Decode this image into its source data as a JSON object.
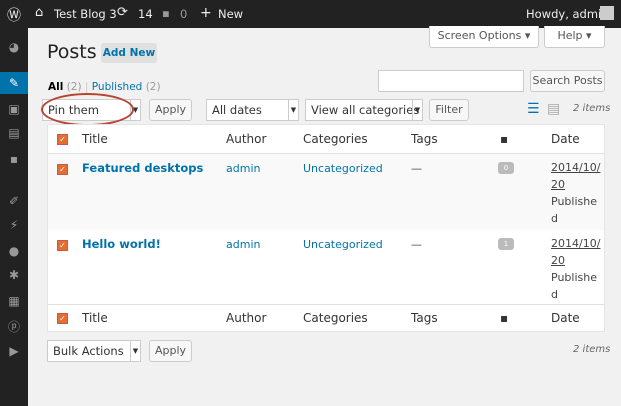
{
  "adminbar": {
    "site": "Test Blog 3",
    "updates": "14",
    "comments": "0",
    "new": "New",
    "howdy": "Howdy, admin"
  },
  "header": {
    "title": "Posts",
    "add_new": "Add New",
    "screen_options": "Screen Options ▾",
    "help": "Help ▾"
  },
  "views": {
    "all": "All",
    "all_count": "(2)",
    "sep": "|",
    "published": "Published",
    "published_count": "(2)"
  },
  "search": {
    "value": "",
    "button": "Search Posts"
  },
  "tablenav_top": {
    "bulk_selected": "Pin them",
    "apply": "Apply",
    "dates": "All dates",
    "categories": "View all categories",
    "filter": "Filter",
    "items": "2 items"
  },
  "columns": {
    "title": "Title",
    "author": "Author",
    "categories": "Categories",
    "tags": "Tags",
    "date": "Date"
  },
  "rows": [
    {
      "title": "Featured desktops",
      "author": "admin",
      "category": "Uncategorized",
      "tags": "—",
      "comments": "0",
      "date1": "2014/10/",
      "date2": "20",
      "status1": "Publishe",
      "status2": "d"
    },
    {
      "title": "Hello world!",
      "author": "admin",
      "category": "Uncategorized",
      "tags": "—",
      "comments": "1",
      "date1": "2014/10/",
      "date2": "20",
      "status1": "Publishe",
      "status2": "d"
    }
  ],
  "tablenav_bottom": {
    "bulk_selected": "Bulk Actions",
    "apply": "Apply",
    "items": "2 items"
  },
  "colors": {
    "accent": "#0073aa",
    "highlight": "#c0392b",
    "checkbox": "#e26f30"
  }
}
